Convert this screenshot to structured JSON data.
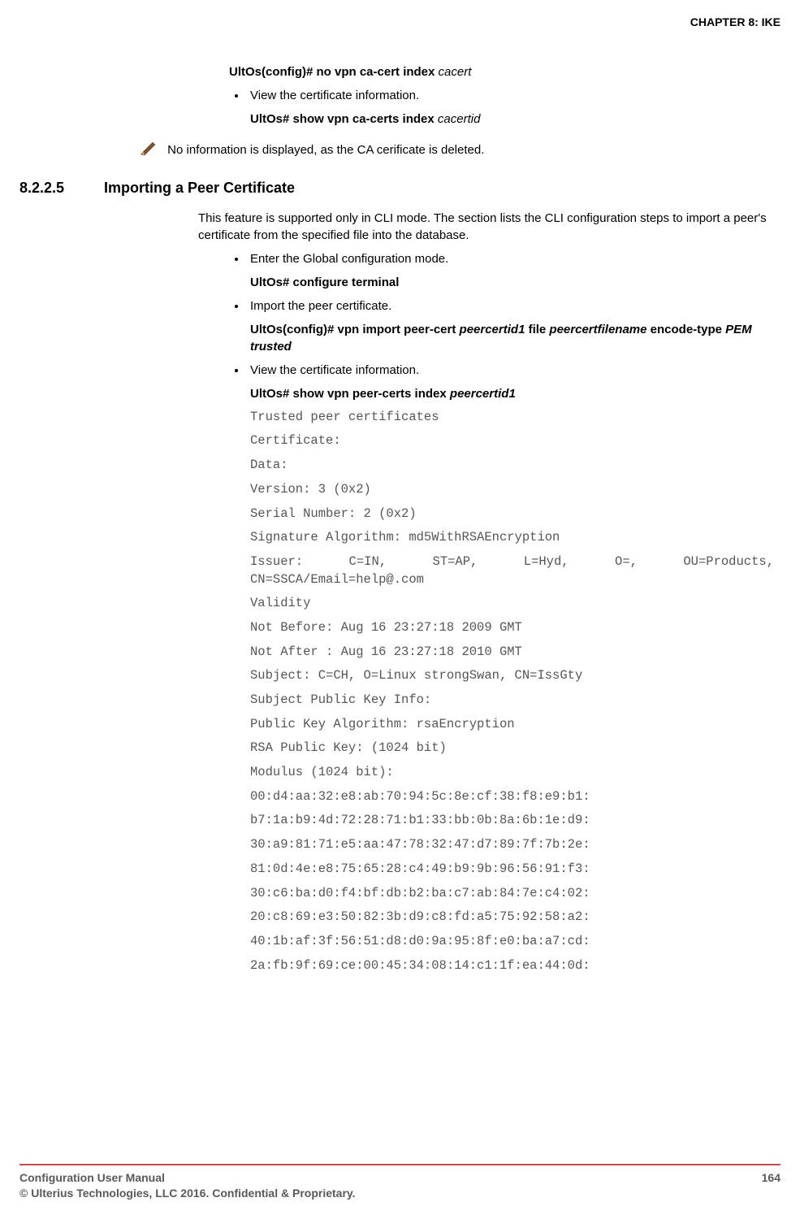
{
  "header": "CHAPTER 8: IKE",
  "pre": {
    "cmd1_prefix": "UltOs(config)# no vpn ca-cert index ",
    "cmd1_arg": "cacert",
    "bullet1": "View the certificate information.",
    "cmd2_prefix": "UltOs# show vpn ca-certs index ",
    "cmd2_arg": "cacertid"
  },
  "note": "No information is displayed, as the CA cerificate is deleted.",
  "section": {
    "num": "8.2.2.5",
    "title": "Importing a Peer Certificate",
    "intro": "This feature is supported only in CLI mode. The section lists the CLI configuration steps to import a peer's certificate from the specified file into the database."
  },
  "steps": {
    "b1": "Enter the Global configuration mode.",
    "c1": "UltOs# configure terminal",
    "b2": "Import the peer certificate.",
    "c2a": "UltOs(config)# vpn import peer-cert ",
    "c2b": "peercertid1",
    "c2c": " file ",
    "c2d": "peercertfilename",
    "c2e": " encode-type ",
    "c2f": "PEM trusted",
    "b3": "View the certificate information.",
    "c3a": "UltOs# show vpn peer-certs index ",
    "c3b": "peercertid1"
  },
  "out": [
    "Trusted peer certificates",
    "Certificate:",
    "Data:",
    "Version: 3 (0x2)",
    "Serial Number: 2 (0x2)",
    "Signature Algorithm: md5WithRSAEncryption",
    "Issuer:  C=IN,  ST=AP,  L=Hyd,  O=,  OU=Products, CN=SSCA/Email=help@.com",
    "Validity",
    "Not Before: Aug 16 23:27:18 2009 GMT",
    "Not After : Aug 16 23:27:18 2010 GMT",
    "Subject: C=CH, O=Linux strongSwan, CN=IssGty",
    "Subject Public Key Info:",
    "Public Key Algorithm: rsaEncryption",
    "RSA Public Key: (1024 bit)",
    "Modulus (1024 bit):",
    "00:d4:aa:32:e8:ab:70:94:5c:8e:cf:38:f8:e9:b1:",
    "b7:1a:b9:4d:72:28:71:b1:33:bb:0b:8a:6b:1e:d9:",
    "30:a9:81:71:e5:aa:47:78:32:47:d7:89:7f:7b:2e:",
    "81:0d:4e:e8:75:65:28:c4:49:b9:9b:96:56:91:f3:",
    "30:c6:ba:d0:f4:bf:db:b2:ba:c7:ab:84:7e:c4:02:",
    "20:c8:69:e3:50:82:3b:d9:c8:fd:a5:75:92:58:a2:",
    "40:1b:af:3f:56:51:d8:d0:9a:95:8f:e0:ba:a7:cd:",
    "2a:fb:9f:69:ce:00:45:34:08:14:c1:1f:ea:44:0d:"
  ],
  "footer": {
    "l1": "Configuration User Manual",
    "l2": "© Ulterius Technologies, LLC 2016. Confidential & Proprietary.",
    "page": "164"
  }
}
